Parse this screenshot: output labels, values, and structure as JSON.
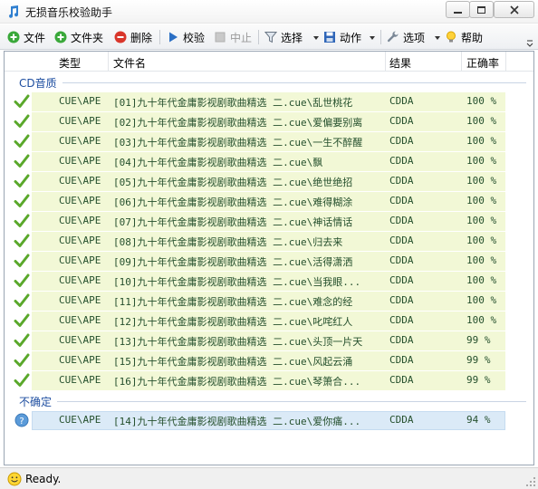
{
  "window": {
    "title": "无损音乐校验助手"
  },
  "toolbar": {
    "file": "文件",
    "folder": "文件夹",
    "delete": "删除",
    "verify": "校验",
    "stop": "中止",
    "select": "选择",
    "action": "动作",
    "options": "选项",
    "help": "帮助"
  },
  "columns": {
    "type": "类型",
    "filename": "文件名",
    "result": "结果",
    "accuracy": "正确率"
  },
  "groups": [
    {
      "title": "CD音质",
      "rows": [
        {
          "type": "CUE\\APE",
          "filename": "[01]九十年代金庸影视剧歌曲精选 二.cue\\乱世桃花",
          "result": "CDDA",
          "accuracy": "100 %"
        },
        {
          "type": "CUE\\APE",
          "filename": "[02]九十年代金庸影视剧歌曲精选 二.cue\\爱偏要别离",
          "result": "CDDA",
          "accuracy": "100 %"
        },
        {
          "type": "CUE\\APE",
          "filename": "[03]九十年代金庸影视剧歌曲精选 二.cue\\一生不醉醒",
          "result": "CDDA",
          "accuracy": "100 %"
        },
        {
          "type": "CUE\\APE",
          "filename": "[04]九十年代金庸影视剧歌曲精选 二.cue\\飘",
          "result": "CDDA",
          "accuracy": "100 %"
        },
        {
          "type": "CUE\\APE",
          "filename": "[05]九十年代金庸影视剧歌曲精选 二.cue\\绝世绝招",
          "result": "CDDA",
          "accuracy": "100 %"
        },
        {
          "type": "CUE\\APE",
          "filename": "[06]九十年代金庸影视剧歌曲精选 二.cue\\难得糊涂",
          "result": "CDDA",
          "accuracy": "100 %"
        },
        {
          "type": "CUE\\APE",
          "filename": "[07]九十年代金庸影视剧歌曲精选 二.cue\\神话情话",
          "result": "CDDA",
          "accuracy": "100 %"
        },
        {
          "type": "CUE\\APE",
          "filename": "[08]九十年代金庸影视剧歌曲精选 二.cue\\归去来",
          "result": "CDDA",
          "accuracy": "100 %"
        },
        {
          "type": "CUE\\APE",
          "filename": "[09]九十年代金庸影视剧歌曲精选 二.cue\\活得潇洒",
          "result": "CDDA",
          "accuracy": "100 %"
        },
        {
          "type": "CUE\\APE",
          "filename": "[10]九十年代金庸影视剧歌曲精选 二.cue\\当我眼...",
          "result": "CDDA",
          "accuracy": "100 %"
        },
        {
          "type": "CUE\\APE",
          "filename": "[11]九十年代金庸影视剧歌曲精选 二.cue\\难念的经",
          "result": "CDDA",
          "accuracy": "100 %"
        },
        {
          "type": "CUE\\APE",
          "filename": "[12]九十年代金庸影视剧歌曲精选 二.cue\\叱咤红人",
          "result": "CDDA",
          "accuracy": "100 %"
        },
        {
          "type": "CUE\\APE",
          "filename": "[13]九十年代金庸影视剧歌曲精选 二.cue\\头顶一片天",
          "result": "CDDA",
          "accuracy": "99 %"
        },
        {
          "type": "CUE\\APE",
          "filename": "[15]九十年代金庸影视剧歌曲精选 二.cue\\风起云涌",
          "result": "CDDA",
          "accuracy": "99 %"
        },
        {
          "type": "CUE\\APE",
          "filename": "[16]九十年代金庸影视剧歌曲精选 二.cue\\琴箫合...",
          "result": "CDDA",
          "accuracy": "99 %"
        }
      ]
    },
    {
      "title": "不确定",
      "rows": [
        {
          "type": "CUE\\APE",
          "filename": "[14]九十年代金庸影视剧歌曲精选 二.cue\\爱你痛...",
          "result": "CDDA",
          "accuracy": "94 %"
        }
      ]
    }
  ],
  "status": {
    "text": "Ready."
  },
  "colors": {
    "row_ok": "#f2f8d6",
    "row_selected": "#dbeaf7",
    "group_title": "#1e4ea0",
    "cell_text": "#244f2c"
  }
}
